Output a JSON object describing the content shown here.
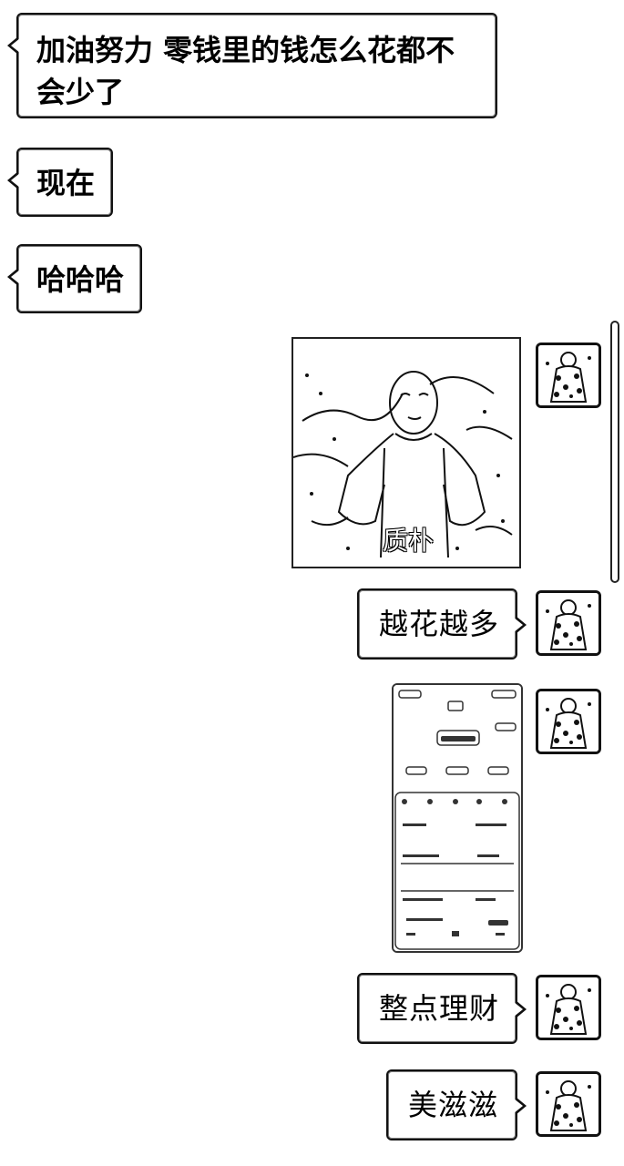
{
  "messages": {
    "m1": "加油努力 零钱里的钱怎么花都不会少了",
    "m2": "现在",
    "m3": "哈哈哈",
    "photo_caption": "质朴",
    "m4": "越花越多",
    "m5": "整点理财",
    "m6": "美滋滋"
  }
}
